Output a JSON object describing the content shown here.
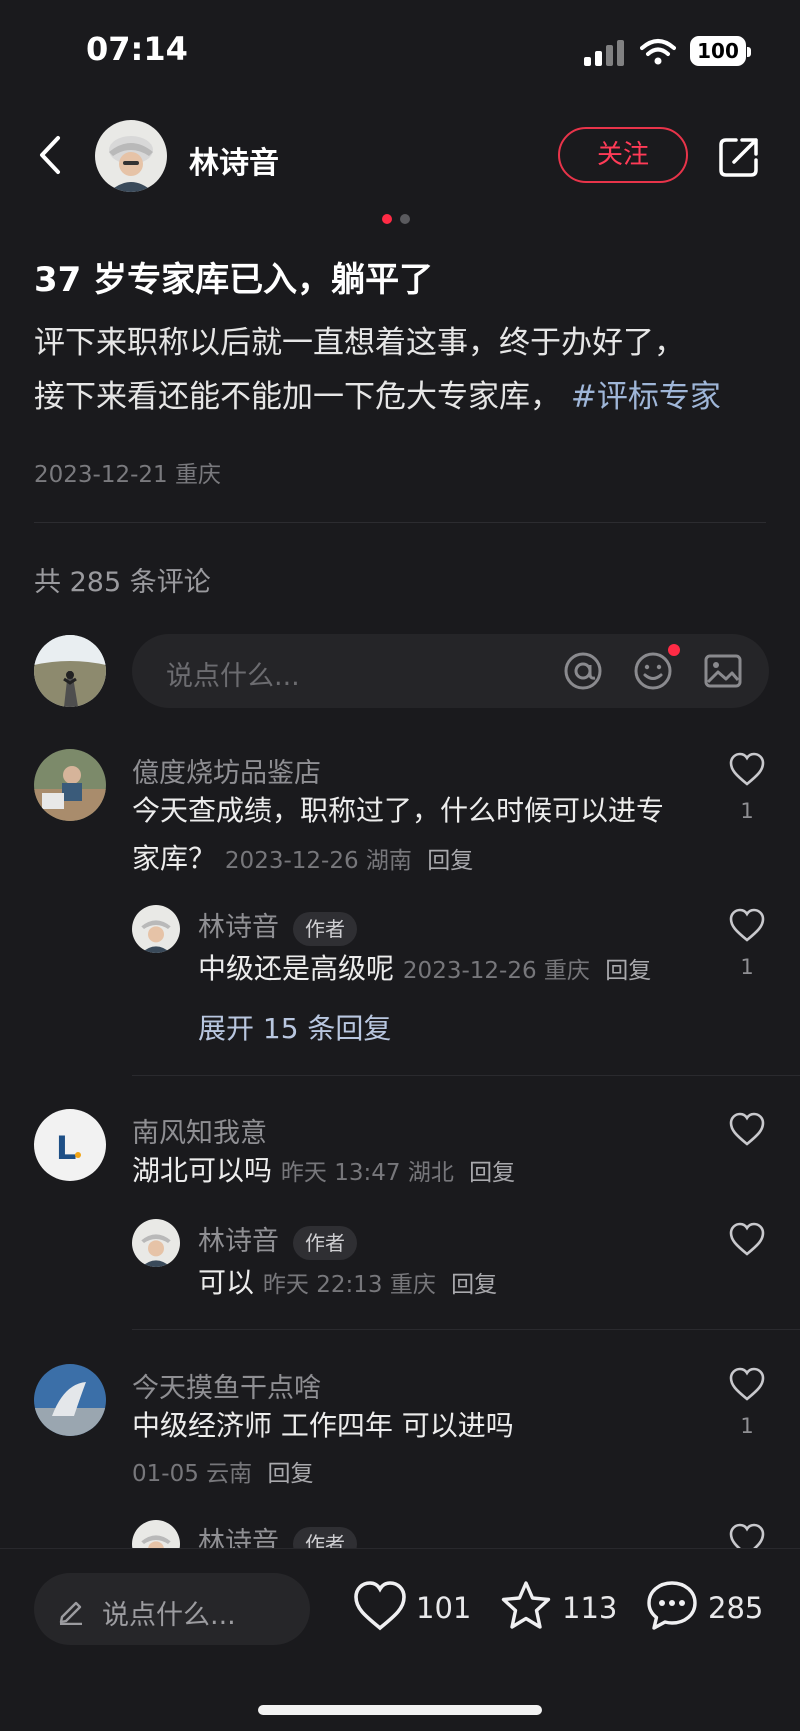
{
  "status_bar": {
    "time": "07:14",
    "battery": "100"
  },
  "header": {
    "author_name": "林诗音",
    "follow_label": "关注"
  },
  "post": {
    "title": "37 岁专家库已入，躺平了",
    "body_line1": "评下来职称以后就一直想着这事，终于办好了，",
    "body_line2": "接下来看还能不能加一下危大专家库，",
    "hashtag": "#评标专家",
    "date": "2023-12-21",
    "location": "重庆"
  },
  "comments_header": {
    "count_text": "共 285 条评论"
  },
  "composer": {
    "placeholder": "说点什么..."
  },
  "comments": [
    {
      "user": "億度烧坊品鉴店",
      "text_line1": "今天查成绩，职称过了，什么时候可以进专",
      "text_line2": "家库？",
      "time": "2023-12-26",
      "location": "湖南",
      "reply": "回复",
      "likes": "1",
      "sub": {
        "user": "林诗音",
        "tag": "作者",
        "text": "中级还是高级呢",
        "time": "2023-12-26",
        "location": "重庆",
        "reply": "回复",
        "likes": "1"
      },
      "expand": "展开 15 条回复"
    },
    {
      "user": "南风知我意",
      "text": "湖北可以吗",
      "time": "昨天 13:47",
      "location": "湖北",
      "reply": "回复",
      "sub": {
        "user": "林诗音",
        "tag": "作者",
        "text": "可以",
        "time": "昨天 22:13",
        "location": "重庆",
        "reply": "回复"
      }
    },
    {
      "user": "今天摸鱼干点啥",
      "text": "中级经济师 工作四年 可以进吗",
      "time": "01-05",
      "location": "云南",
      "reply": "回复",
      "likes": "1",
      "sub": {
        "user": "林诗音",
        "tag": "作者"
      }
    }
  ],
  "bottom_bar": {
    "input_placeholder": "说点什么...",
    "likes": "101",
    "stars": "113",
    "comments": "285"
  },
  "colors": {
    "accent": "#ff3b57",
    "background": "#1a1a1d",
    "hashtag": "#9fb6d8"
  },
  "icons": [
    "back-icon",
    "share-icon",
    "at-icon",
    "emoji-icon",
    "image-icon",
    "heart-icon",
    "star-icon",
    "comment-icon",
    "pencil-icon"
  ]
}
